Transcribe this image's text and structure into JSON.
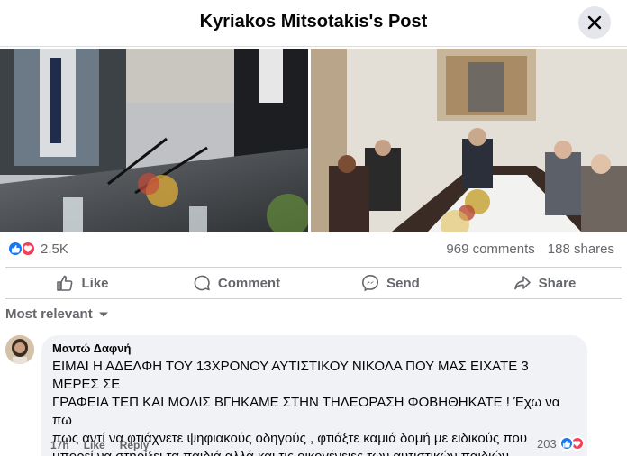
{
  "header": {
    "title": "Kyriakos Mitsotakis's Post",
    "close_icon": "close-icon"
  },
  "stats": {
    "reaction_count": "2.5K",
    "comments": "969 comments",
    "shares": "188 shares",
    "reaction_icons": [
      "like-icon",
      "love-icon"
    ]
  },
  "actions": {
    "like": "Like",
    "comment": "Comment",
    "send": "Send",
    "share": "Share"
  },
  "sort": {
    "label": "Most relevant"
  },
  "comment": {
    "author": "Μαντώ Δαφνή",
    "lines": [
      "ΕΙΜΑΙ Η ΑΔΕΛΦΗ ΤΟΥ 13ΧΡΟΝΟΥ ΑΥΤΙΣΤΙΚΟΥ ΝΙΚΟΛΑ ΠΟΥ ΜΑΣ ΕΙΧΑΤΕ 3 ΜΕΡΕΣ ΣΕ",
      "ΓΡΑΦΕΙΑ ΤΕΠ ΚΑΙ ΜΟΛΙΣ ΒΓΗΚΑΜΕ ΣΤΗΝ ΤΗΛΕΟΡΑΣΗ ΦΟΒΗΘΗΚΑΤΕ ! Έχω να πω",
      "πως αντί να φτιάχνετε ψηφιακούς οδηγούς , φτιάξτε καμιά δομή με ειδικούς που",
      "μπορεί να στηρίξει τα παιδιά αλλά και τις οικογένειες των αυτιστικών παιδιών"
    ],
    "time": "17h",
    "like": "Like",
    "reply": "Reply",
    "reaction_count": "203"
  },
  "colors": {
    "accent": "#1877f2",
    "love": "#f33e58",
    "secondary_text": "#65676b",
    "bubble": "#f0f2f5"
  }
}
